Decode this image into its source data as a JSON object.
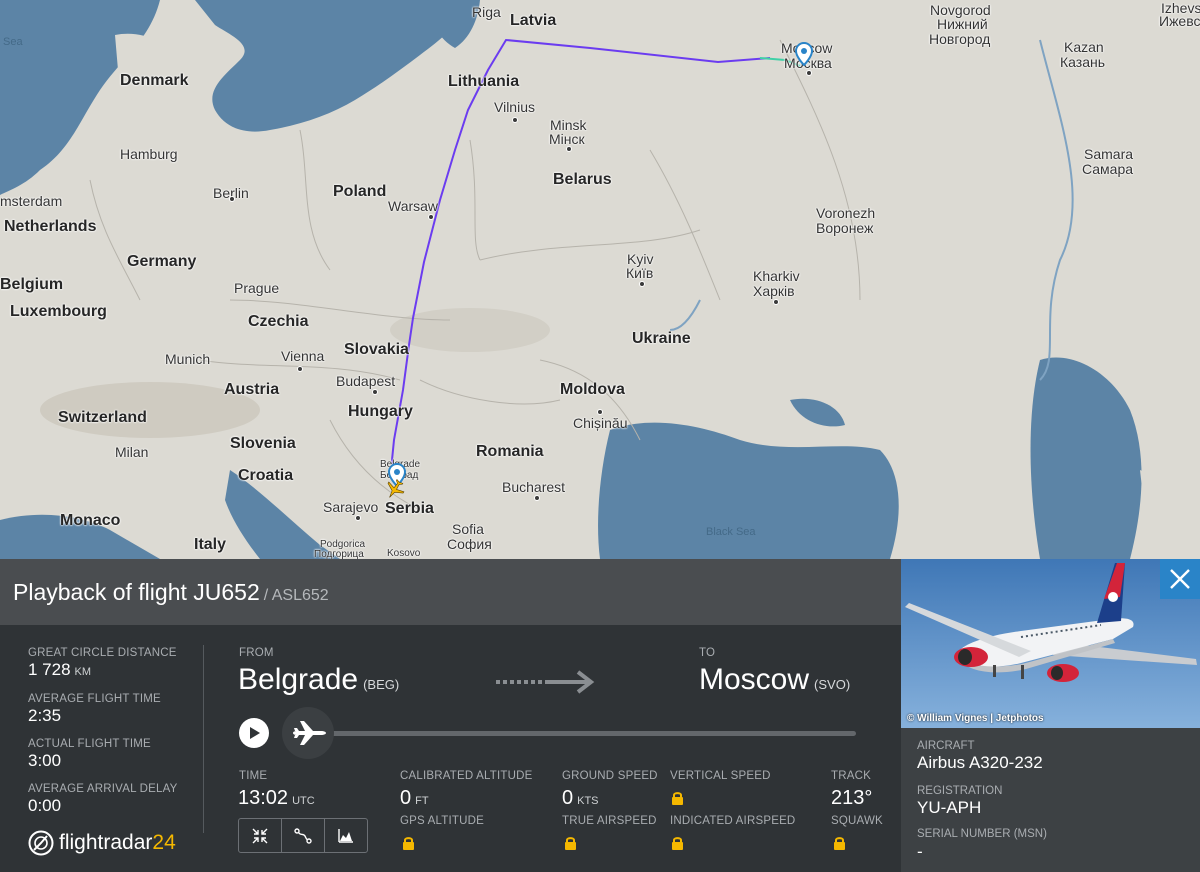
{
  "map": {
    "countries": [
      "Latvia",
      "Denmark",
      "Lithuania",
      "Belarus",
      "Poland",
      "Netherlands",
      "Germany",
      "Belgium",
      "Luxembourg",
      "Czechia",
      "Slovakia",
      "Austria",
      "Switzerland",
      "Hungary",
      "Slovenia",
      "Croatia",
      "Romania",
      "Moldova",
      "Ukraine",
      "Serbia",
      "Monaco",
      "Italy"
    ],
    "cities": {
      "riga": "Riga",
      "moscow_en": "Moscow",
      "moscow_ru": "Москва",
      "nizhny_en": "Novgorod",
      "nizhny_ru1": "Нижний",
      "nizhny_ru2": "Новгород",
      "izhevsk_en": "Izhevs",
      "izhevsk_ru": "Ижевс",
      "kazan_en": "Kazan",
      "kazan_ru": "Казань",
      "vilnius": "Vilnius",
      "minsk_en": "Minsk",
      "minsk_ru": "Мінск",
      "hamburg": "Hamburg",
      "berlin": "Berlin",
      "amsterdam": "msterdam",
      "warsaw": "Warsaw",
      "samara_en": "Samara",
      "samara_ru": "Самара",
      "voronezh_en": "Voronezh",
      "voronezh_ru": "Воронеж",
      "kyiv_en": "Kyiv",
      "kyiv_ru": "Київ",
      "kharkiv_en": "Kharkiv",
      "kharkiv_ru": "Харків",
      "prague": "Prague",
      "munich": "Munich",
      "vienna": "Vienna",
      "budapest": "Budapest",
      "chisinau": "Chișinău",
      "milan": "Milan",
      "belgrade_en": "Belgrade",
      "belgrade_ru": "Београд",
      "bucharest": "Bucharest",
      "sarajevo": "Sarajevo",
      "sofia_en": "Sofia",
      "sofia_ru": "София",
      "podgorica_en": "Podgorica",
      "podgorica_ru": "Подгорица",
      "kosovo": "Kosovo"
    },
    "seas": {
      "black_sea": "Black Sea",
      "sea": "Sea"
    },
    "colors": {
      "water": "#5c84a6",
      "land": "#dcdad3",
      "route": "#6b3cf0",
      "route_end": "#3fd0a6"
    }
  },
  "panel": {
    "title": "Playback of flight JU652",
    "callsign": "/ ASL652",
    "stats": {
      "distance_label": "GREAT CIRCLE DISTANCE",
      "distance_value": "1 728",
      "distance_unit": "KM",
      "avg_time_label": "AVERAGE FLIGHT TIME",
      "avg_time_value": "2:35",
      "actual_time_label": "ACTUAL FLIGHT TIME",
      "actual_time_value": "3:00",
      "delay_label": "AVERAGE ARRIVAL DELAY",
      "delay_value": "0:00"
    },
    "route": {
      "from_label": "FROM",
      "from_city": "Belgrade",
      "from_code": "(BEG)",
      "to_label": "TO",
      "to_city": "Moscow",
      "to_code": "(SVO)"
    },
    "telemetry": {
      "time_label": "TIME",
      "time_value": "13:02",
      "time_unit": "UTC",
      "cal_alt_label": "CALIBRATED ALTITUDE",
      "cal_alt_value": "0",
      "cal_alt_unit": "FT",
      "gps_alt_label": "GPS ALTITUDE",
      "ground_speed_label": "GROUND SPEED",
      "ground_speed_value": "0",
      "ground_speed_unit": "KTS",
      "true_airspeed_label": "TRUE AIRSPEED",
      "vertical_speed_label": "VERTICAL SPEED",
      "indicated_airspeed_label": "INDICATED AIRSPEED",
      "track_label": "TRACK",
      "track_value": "213°",
      "squawk_label": "SQUAWK"
    },
    "playback_progress": 0,
    "logo": {
      "main": "flightradar",
      "accent": "24"
    }
  },
  "aircraft": {
    "photo_credit": "© William Vignes | Jetphotos",
    "aircraft_label": "AIRCRAFT",
    "aircraft_value": "Airbus A320-232",
    "registration_label": "REGISTRATION",
    "registration_value": "YU-APH",
    "serial_label": "SERIAL NUMBER (MSN)",
    "serial_value": "-"
  }
}
